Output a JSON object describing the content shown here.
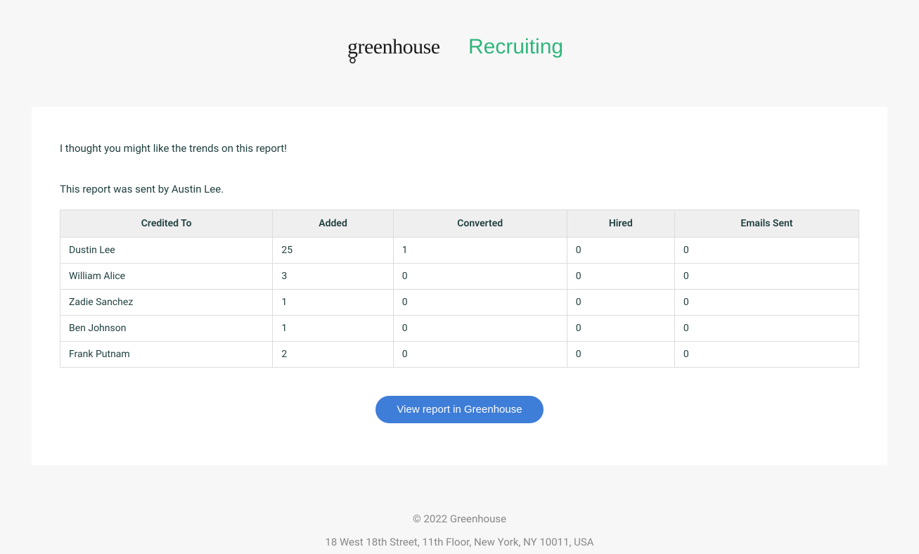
{
  "logo": {
    "brand": "greenhouse",
    "product": "Recruiting"
  },
  "intro": "I thought you might like the trends on this report!",
  "sent_by": "This report was sent by Austin Lee.",
  "table": {
    "headers": {
      "credited_to": "Credited To",
      "added": "Added",
      "converted": "Converted",
      "hired": "Hired",
      "emails_sent": "Emails Sent"
    },
    "rows": [
      {
        "credited_to": "Dustin Lee",
        "added": "25",
        "converted": "1",
        "hired": "0",
        "emails_sent": "0"
      },
      {
        "credited_to": "William Alice",
        "added": "3",
        "converted": "0",
        "hired": "0",
        "emails_sent": "0"
      },
      {
        "credited_to": "Zadie Sanchez",
        "added": "1",
        "converted": "0",
        "hired": "0",
        "emails_sent": "0"
      },
      {
        "credited_to": "Ben Johnson",
        "added": "1",
        "converted": "0",
        "hired": "0",
        "emails_sent": "0"
      },
      {
        "credited_to": "Frank Putnam",
        "added": "2",
        "converted": "0",
        "hired": "0",
        "emails_sent": "0"
      }
    ]
  },
  "button_label": "View report in Greenhouse",
  "footer": {
    "copyright": "© 2022 Greenhouse",
    "address": "18 West 18th Street, 11th Floor, New York, NY 10011, USA"
  }
}
